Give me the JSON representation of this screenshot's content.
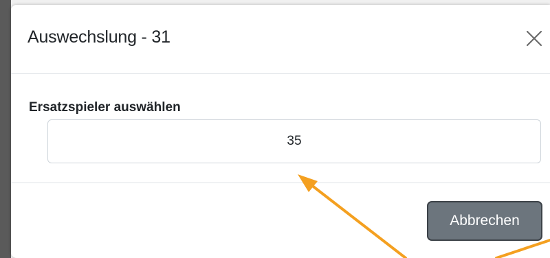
{
  "modal": {
    "title": "Auswechslung - 31",
    "close_icon": "close-x-icon"
  },
  "form": {
    "label": "Ersatzspieler auswählen",
    "selected_value": "35"
  },
  "footer": {
    "cancel_label": "Abbrechen"
  },
  "annotation": {
    "arrow_color": "#f4a020",
    "arrow_icon": "annotation-arrow"
  },
  "colors": {
    "button_secondary": "#6c757d",
    "border": "#dee2e6",
    "text": "#212529"
  }
}
